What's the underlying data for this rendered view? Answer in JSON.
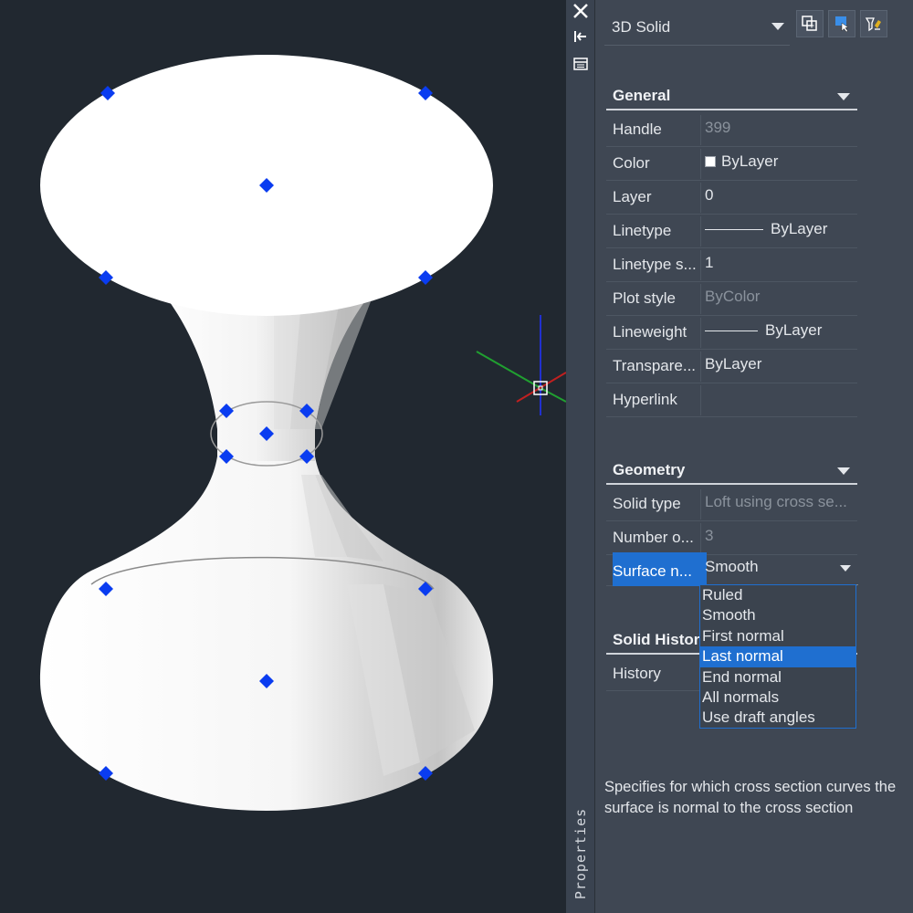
{
  "palette": {
    "viewport_bg": "#212830",
    "panel_bg": "#3f4753",
    "strip_bg": "#3a4350",
    "selection_blue": "#1f6fd0",
    "grip_blue": "#0a3cf0",
    "muted_text": "#8a929c"
  },
  "viewport": {
    "shape": "lofted hourglass 3D solid",
    "grip_icon": "blue-diamond-grip-icon",
    "ucs_icon": "ucs-axes-icon"
  },
  "strip": {
    "close_icon": "close-icon",
    "autohide_icon": "auto-hide-icon",
    "menu_icon": "properties-menu-icon",
    "label": "Properties"
  },
  "header": {
    "object_type": "3D Solid",
    "buttons": [
      "toggle-pickadd-icon",
      "select-objects-icon",
      "quick-select-icon"
    ]
  },
  "general": {
    "title": "General",
    "rows": [
      {
        "label": "Handle",
        "value": "399",
        "muted": true
      },
      {
        "label": "Color",
        "value": "ByLayer"
      },
      {
        "label": "Layer",
        "value": "0"
      },
      {
        "label": "Linetype",
        "value": "ByLayer"
      },
      {
        "label": "Linetype s...",
        "value": "1"
      },
      {
        "label": "Plot style",
        "value": "ByColor",
        "muted": true
      },
      {
        "label": "Lineweight",
        "value": "ByLayer"
      },
      {
        "label": "Transpare...",
        "value": "ByLayer"
      },
      {
        "label": "Hyperlink",
        "value": ""
      }
    ]
  },
  "geometry": {
    "title": "Geometry",
    "rows": [
      {
        "label": "Solid type",
        "value": "Loft using cross se...",
        "muted": true
      },
      {
        "label": "Number o...",
        "value": "3",
        "muted": true
      },
      {
        "label": "Surface n...",
        "value": "Smooth"
      }
    ]
  },
  "solid_history": {
    "title": "Solid Histor",
    "rows": [
      {
        "label": "History",
        "value": ""
      }
    ]
  },
  "dropdown": {
    "options": [
      "Ruled",
      "Smooth",
      "First normal",
      "Last normal",
      "End normal",
      "All normals",
      "Use draft angles"
    ],
    "selected": "Last normal"
  },
  "description": "Specifies for which cross section curves the surface is normal to the cross section"
}
